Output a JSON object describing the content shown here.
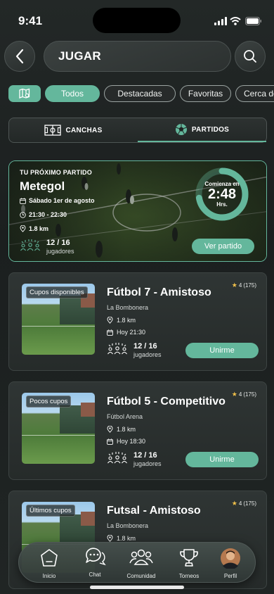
{
  "status": {
    "time": "9:41"
  },
  "search": {
    "value": "JUGAR"
  },
  "filters": [
    {
      "label": "Todos",
      "active": true
    },
    {
      "label": "Destacadas",
      "active": false
    },
    {
      "label": "Favoritas",
      "active": false
    },
    {
      "label": "Cerca de ti",
      "active": false
    }
  ],
  "segments": {
    "canchas": "CANCHAS",
    "partidos": "PARTIDOS",
    "selected": "PARTIDOS"
  },
  "next_match": {
    "label": "TU PRÓXIMO PARTIDO",
    "title": "Metegol",
    "date": "Sábado 1er de agosto",
    "time": "21:30 - 22:30",
    "distance": "1.8 km",
    "players": "12 / 16",
    "players_label": "jugadores",
    "countdown_label": "Comienza en",
    "countdown_value": "2:48",
    "countdown_unit": "Hrs.",
    "button": "Ver partido"
  },
  "matches": [
    {
      "tag": "Cupos disponibles",
      "title": "Fútbol 7 - Amistoso",
      "venue": "La Bombonera",
      "distance": "1.8 km",
      "when": "Hoy 21:30",
      "players": "12 / 16",
      "players_label": "jugadores",
      "rating": "4",
      "reviews": "(175)",
      "button": "Unirme"
    },
    {
      "tag": "Pocos cupos",
      "title": "Fútbol 5 - Competitivo",
      "venue": "Fútbol Arena",
      "distance": "1.8 km",
      "when": "Hoy 18:30",
      "players": "12 / 16",
      "players_label": "jugadores",
      "rating": "4",
      "reviews": "(175)",
      "button": "Unirme"
    },
    {
      "tag": "Últimos cupos",
      "title": "Futsal - Amistoso",
      "venue": "La Bombonera",
      "distance": "1.8 km",
      "rating": "4",
      "reviews": "(175)"
    }
  ],
  "nav": [
    {
      "label": "Inicio",
      "icon": "home-icon"
    },
    {
      "label": "Chat",
      "icon": "chat-icon"
    },
    {
      "label": "Comunidad",
      "icon": "community-icon"
    },
    {
      "label": "Torneos",
      "icon": "trophy-icon"
    },
    {
      "label": "Perfil",
      "icon": "avatar"
    }
  ],
  "colors": {
    "accent": "#64b79c",
    "background": "#1d2121",
    "star": "#f0c04a"
  }
}
